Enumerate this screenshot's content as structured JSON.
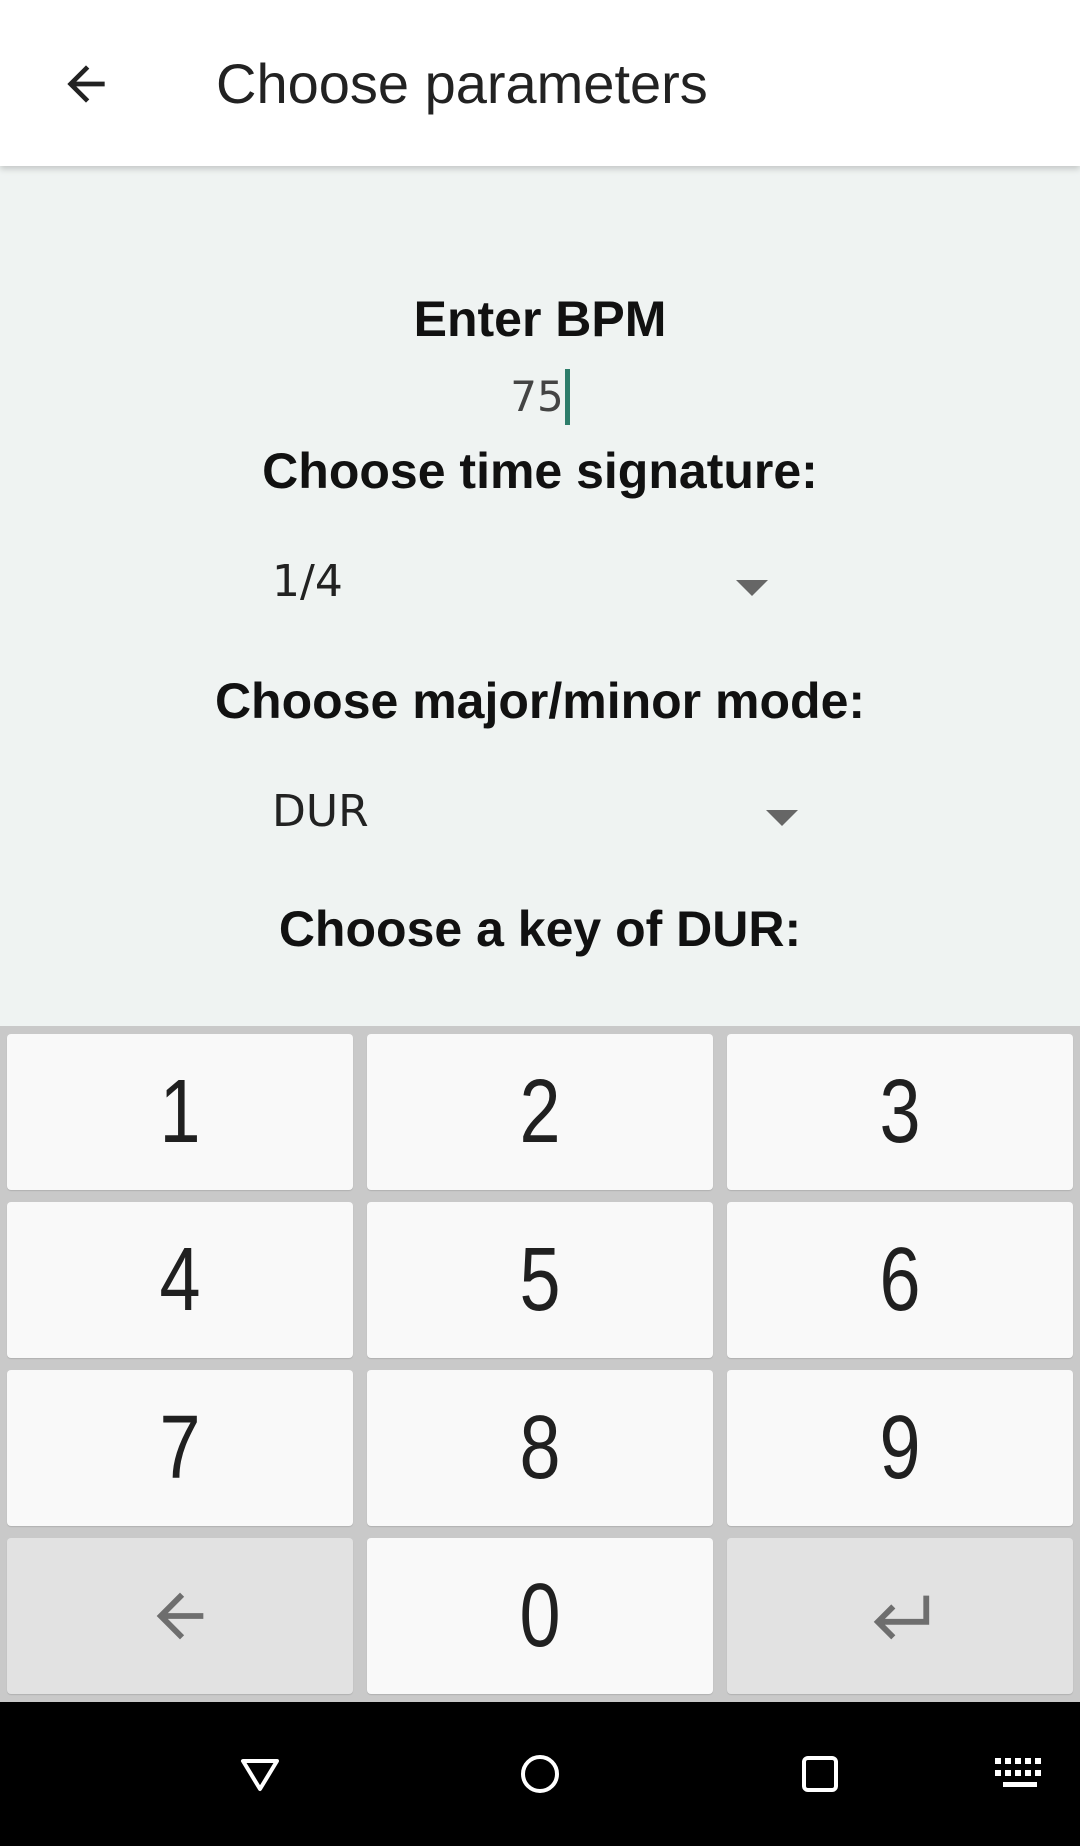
{
  "app_bar": {
    "title": "Choose parameters",
    "back_icon": "arrow-left-icon"
  },
  "form": {
    "bpm_label": "Enter BPM",
    "bpm_value": "75",
    "time_signature_label": "Choose time signature:",
    "time_signature_value": "1/4",
    "mode_label": "Choose major/minor mode:",
    "mode_value": "DUR",
    "key_label": "Choose a key of DUR:"
  },
  "keyboard": {
    "keys": [
      "1",
      "2",
      "3",
      "4",
      "5",
      "6",
      "7",
      "8",
      "9",
      "0"
    ],
    "backspace_icon": "backspace-arrow-icon",
    "enter_icon": "enter-return-icon"
  },
  "nav_bar": {
    "back_icon": "nav-back-triangle-icon",
    "home_icon": "nav-home-circle-icon",
    "recents_icon": "nav-recents-square-icon",
    "keyboard_icon": "keyboard-switch-icon"
  },
  "colors": {
    "background": "#eff3f2",
    "app_bar": "#ffffff",
    "caret": "#2e7d6b",
    "keyboard_bg": "#c9c9c9",
    "key_bg": "#f9f9f9",
    "func_key_bg": "#e2e2e2",
    "nav_bar": "#000000"
  }
}
